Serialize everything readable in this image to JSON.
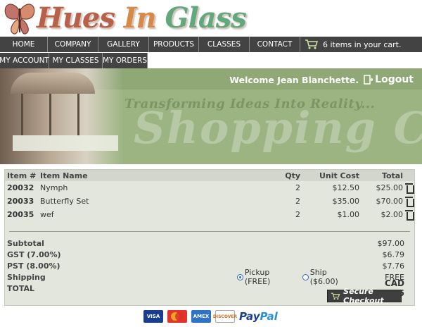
{
  "brand": {
    "logo_words": [
      "Hues",
      "In",
      "Glass"
    ]
  },
  "nav_main": {
    "items": [
      "HOME",
      "COMPANY",
      "GALLERY",
      "PRODUCTS",
      "CLASSES",
      "CONTACT"
    ],
    "cart_summary": "6 items in your cart."
  },
  "nav_account": {
    "items": [
      "MY ACCOUNT",
      "MY CLASSES",
      "MY ORDERS"
    ]
  },
  "banner": {
    "welcome": "Welcome Jean Blanchette.",
    "logout_label": "Logout",
    "tagline": "Transforming Ideas Into Reality...",
    "title": "Shopping Cart"
  },
  "cart": {
    "headers": {
      "item_num": "Item #",
      "item_name": "Item Name",
      "qty": "Qty",
      "unit_cost": "Unit Cost",
      "total": "Total"
    },
    "rows": [
      {
        "num": "20032",
        "name": "Nymph",
        "qty": "2",
        "unit_cost": "$12.50",
        "total": "$25.00"
      },
      {
        "num": "20033",
        "name": "Butterfly Set",
        "qty": "2",
        "unit_cost": "$35.00",
        "total": "$70.00"
      },
      {
        "num": "20035",
        "name": "wef",
        "qty": "2",
        "unit_cost": "$1.00",
        "total": "$2.00"
      }
    ],
    "summary": {
      "subtotal_label": "Subtotal",
      "subtotal": "$97.00",
      "gst_label": "GST (7.00%)",
      "gst": "$6.79",
      "pst_label": "PST (8.00%)",
      "pst": "$7.76",
      "shipping_label": "Shipping",
      "shipping": "FREE",
      "shipping_options": {
        "pickup": "Pickup (FREE)",
        "ship": "Ship ($6.00)",
        "selected": "pickup"
      },
      "total_label": "TOTAL",
      "total": "CAD $111.55"
    },
    "checkout_label": "Secure Checkout"
  },
  "payment_methods": {
    "visa": "VISA",
    "mastercard": "MasterCard",
    "amex": "AMEX",
    "discover": "DISCOVER",
    "paypal_a": "Pay",
    "paypal_b": "Pal"
  },
  "colors": {
    "nav_bg": "#434343",
    "banner_green": "#9cb482",
    "panel_bg": "#e3e6dd",
    "link_blue": "#2c6ac4"
  }
}
